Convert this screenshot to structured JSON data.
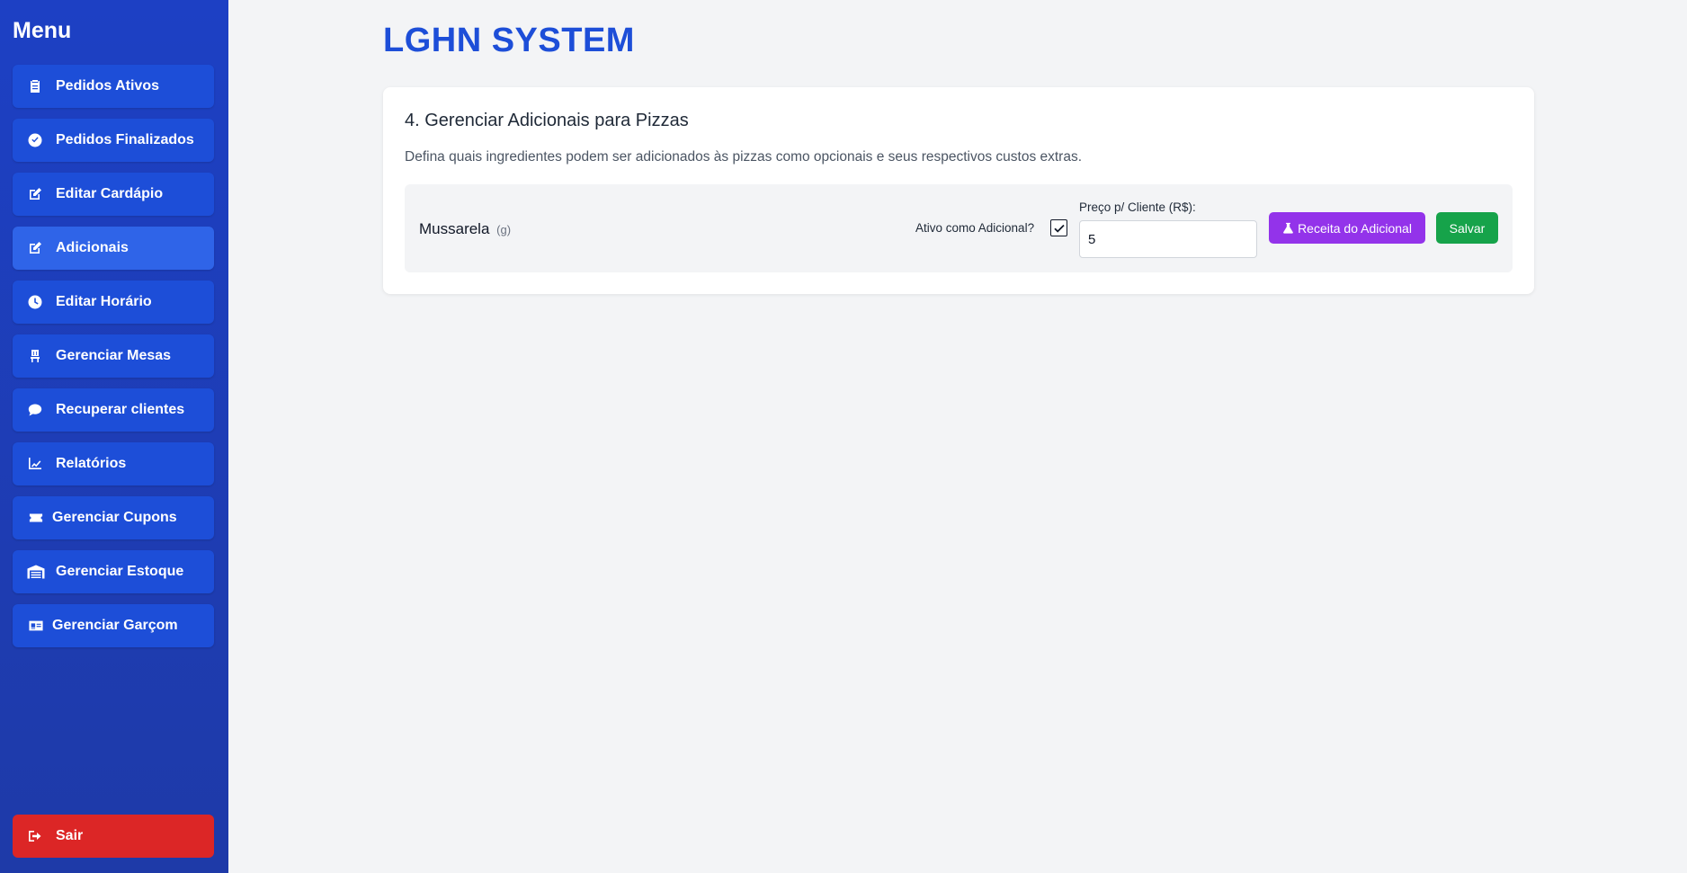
{
  "sidebar": {
    "title": "Menu",
    "items": [
      {
        "label": "Pedidos Ativos",
        "icon": "clipboard-icon"
      },
      {
        "label": "Pedidos Finalizados",
        "icon": "check-circle-icon"
      },
      {
        "label": "Editar Cardápio",
        "icon": "edit-icon"
      },
      {
        "label": "Adicionais",
        "icon": "edit-icon",
        "active": true
      },
      {
        "label": "Editar Horário",
        "icon": "clock-icon"
      },
      {
        "label": "Gerenciar Mesas",
        "icon": "chair-icon"
      },
      {
        "label": "Recuperar clientes",
        "icon": "comment-icon"
      },
      {
        "label": "Relatórios",
        "icon": "chart-line-icon"
      },
      {
        "label": "Gerenciar Cupons",
        "icon": "ticket-icon"
      },
      {
        "label": "Gerenciar Estoque",
        "icon": "warehouse-icon"
      },
      {
        "label": "Gerenciar Garçom",
        "icon": "id-card-icon"
      }
    ],
    "logout_label": "Sair"
  },
  "header": {
    "title": "LGHN SYSTEM"
  },
  "section": {
    "title": "4. Gerenciar Adicionais para Pizzas",
    "description": "Defina quais ingredientes podem ser adicionados às pizzas como opcionais e seus respectivos custos extras.",
    "items": [
      {
        "name": "Mussarela",
        "unit": "(g)",
        "active_label": "Ativo como Adicional?",
        "active": true,
        "price_label": "Preço p/ Cliente (R$):",
        "price_value": "5",
        "recipe_label": "Receita do Adicional",
        "save_label": "Salvar"
      }
    ]
  },
  "colors": {
    "sidebar": "#1d4ed8",
    "accent": "#1d4ed8",
    "logout": "#dc2626",
    "recipe_button": "#9333ea",
    "save_button": "#16a34a"
  }
}
